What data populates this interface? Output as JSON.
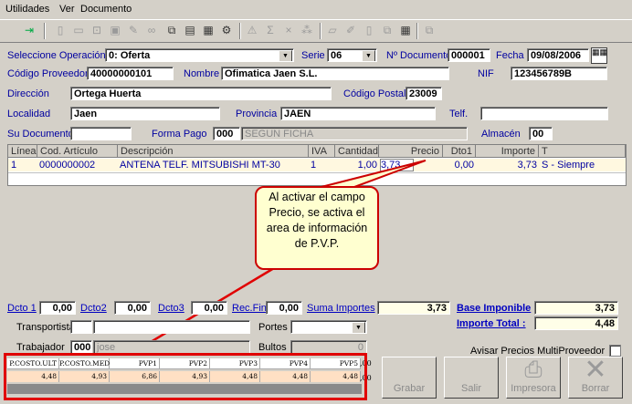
{
  "menu": {
    "utilidades": "Utilidades",
    "ver": "Ver",
    "documento": "Documento"
  },
  "labels": {
    "operacion": "Seleccione Operación",
    "serie": "Serie",
    "numdoc": "Nº Documento",
    "fecha": "Fecha",
    "cod_prov": "Código Proveedor",
    "nombre": "Nombre",
    "nif": "NIF",
    "direccion": "Dirección",
    "cp": "Código Postal",
    "localidad": "Localidad",
    "provincia": "Provincia",
    "telf": "Telf.",
    "su_doc": "Su Documento",
    "forma_pago": "Forma Pago",
    "almacen": "Almacén",
    "dcto1": "Dcto 1",
    "dcto2": "Dcto2",
    "dcto3": "Dcto3",
    "recfin": "Rec.Fin",
    "suma": "Suma Importes",
    "base": "Base Imponible",
    "total": "Importe Total :",
    "transportista": "Transportista",
    "portes": "Portes",
    "trabajador": "Trabajador",
    "bultos": "Bultos",
    "avisar": "Avisar Precios MultiProveedor"
  },
  "values": {
    "operacion": "0: Oferta",
    "serie": "06",
    "numdoc": "000001",
    "fecha": "09/08/2006",
    "cod_prov": "40000000101",
    "nombre": "Ofimatica Jaen S.L.",
    "nif": "123456789B",
    "direccion": "Ortega Huerta",
    "cp": "23009",
    "localidad": "Jaen",
    "provincia": "JAEN",
    "forma_pago_code": "000",
    "forma_pago_desc": "SEGUN FICHA",
    "almacen": "00",
    "dcto1": "0,00",
    "dcto2": "0,00",
    "dcto3": "0,00",
    "recfin": "0,00",
    "suma": "3,73",
    "base": "3,73",
    "total": "4,48",
    "trabajador_code": "000",
    "trabajador_name": "jose",
    "bultos": "0"
  },
  "grid": {
    "headers": [
      "Línea",
      "Cod. Artículo",
      "Descripción",
      "IVA",
      "Cantidad",
      "Precio",
      "Dto1",
      "Importe",
      "T"
    ],
    "row": [
      "1",
      "0000000002",
      "ANTENA TELF. MITSUBISHI MT-30",
      "1",
      "1,00",
      "3,73",
      "0,00",
      "3,73",
      "S - Siempre"
    ]
  },
  "callout": {
    "line1": "Al activar el campo",
    "line2": "Precio, se activa el",
    "line3": "area de información",
    "line4": "de P.V.P."
  },
  "pvp": {
    "headers": [
      "P.COSTO.ULT",
      "P.COSTO.MED",
      "PVP1",
      "PVP2",
      "PVP3",
      "PVP4",
      "PVP5"
    ],
    "values": [
      "4,48",
      "4,93",
      "6,86",
      "4,93",
      "4,48",
      "4,48",
      "4,48"
    ],
    "edge_top": ",00",
    "edge_bot": ",00"
  },
  "buttons": {
    "grabar": "Grabar",
    "salir": "Salir",
    "impresora": "Impresora",
    "borrar": "Borrar"
  },
  "colors": {
    "highlight_box": "#e00000",
    "link_blue": "#0000c0",
    "grid_text": "#0000a0"
  }
}
